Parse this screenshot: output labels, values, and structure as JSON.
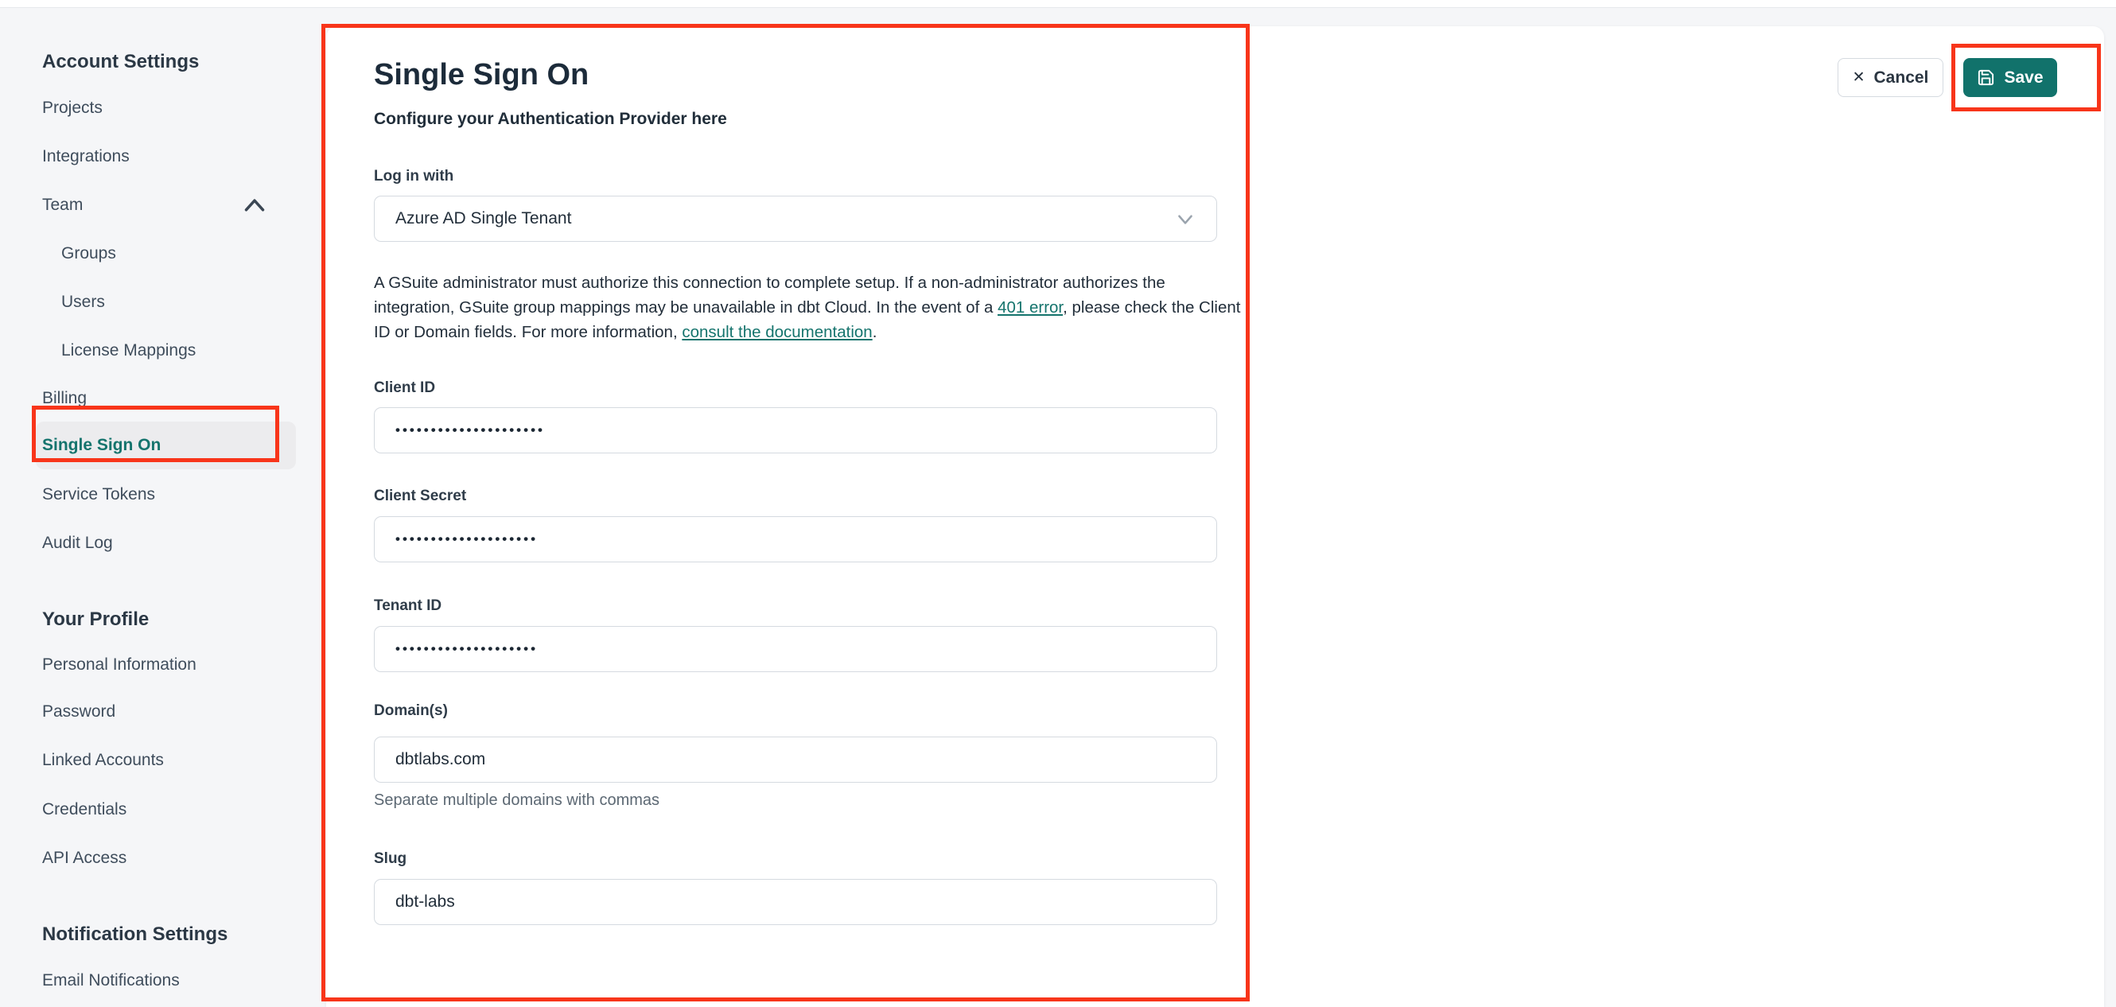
{
  "colors": {
    "accent_teal": "#11726B",
    "active_item_teal": "#15746D",
    "annotation_red": "#F8351A",
    "page_background": "#F5F6F8",
    "card_background": "#FFFFFF"
  },
  "icons": {
    "save-icon": "floppy-disk outline",
    "close-icon": "✕",
    "chevron-up-icon": "∧",
    "chevron-down-icon": "∨"
  },
  "sidebar": {
    "sections": [
      {
        "header": "Account Settings",
        "items": [
          {
            "label": "Projects"
          },
          {
            "label": "Integrations"
          },
          {
            "label": "Team"
          },
          {
            "label": "Groups"
          },
          {
            "label": "Users"
          },
          {
            "label": "License Mappings"
          },
          {
            "label": "Billing"
          },
          {
            "label": "Single Sign On"
          },
          {
            "label": "Service Tokens"
          },
          {
            "label": "Audit Log"
          }
        ]
      },
      {
        "header": "Your Profile",
        "items": [
          {
            "label": "Personal Information"
          },
          {
            "label": "Password"
          },
          {
            "label": "Linked Accounts"
          },
          {
            "label": "Credentials"
          },
          {
            "label": "API Access"
          }
        ]
      },
      {
        "header": "Notification Settings",
        "items": [
          {
            "label": "Email Notifications"
          }
        ]
      }
    ]
  },
  "header": {
    "title": "Single Sign On",
    "subtitle": "Configure your Authentication Provider here",
    "cancel_label": "Cancel",
    "save_label": "Save"
  },
  "form": {
    "login_with": {
      "label": "Log in with",
      "value": "Azure AD Single Tenant"
    },
    "info": {
      "line1": "A GSuite administrator must authorize this connection to complete setup. If a non-administrator authorizes the",
      "line2_pre": "integration, GSuite group mappings may be unavailable in dbt Cloud. In the event of a ",
      "link_401": "401 error",
      "line2_post": ", please check the Client",
      "line3_pre": "ID or Domain fields. For more information, ",
      "link_docs": "consult the documentation",
      "line3_post": "."
    },
    "client_id": {
      "label": "Client ID",
      "value": "•••••••••••••••••••••"
    },
    "client_secret": {
      "label": "Client Secret",
      "value": "••••••••••••••••••••"
    },
    "tenant_id": {
      "label": "Tenant ID",
      "value": "••••••••••••••••••••"
    },
    "domains": {
      "label": "Domain(s)",
      "value": "dbtlabs.com",
      "helper": "Separate multiple domains with commas"
    },
    "slug": {
      "label": "Slug",
      "value": "dbt-labs"
    }
  }
}
